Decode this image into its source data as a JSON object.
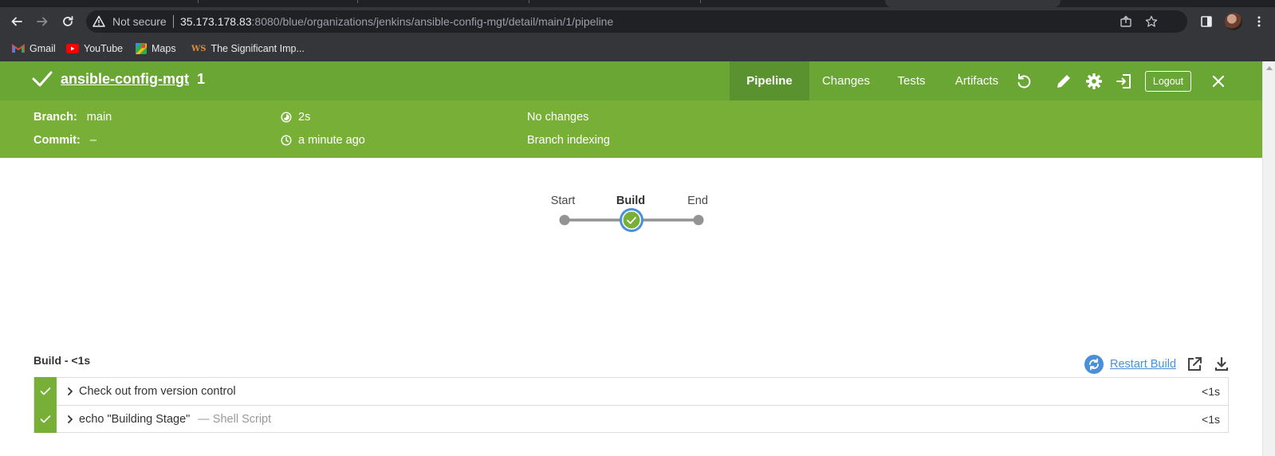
{
  "browser": {
    "security_label": "Not secure",
    "url_host": "35.173.178.83",
    "url_rest": ":8080/blue/organizations/jenkins/ansible-config-mgt/detail/main/1/pipeline",
    "bookmarks": [
      {
        "label": "Gmail",
        "icon": "gmail-icon"
      },
      {
        "label": "YouTube",
        "icon": "youtube-icon"
      },
      {
        "label": "Maps",
        "icon": "maps-icon"
      },
      {
        "label": "The Significant Imp...",
        "icon": "ws-icon"
      }
    ]
  },
  "run": {
    "status": "success",
    "pipeline_name": "ansible-config-mgt",
    "run_number": "1"
  },
  "tabs": [
    {
      "label": "Pipeline",
      "active": true
    },
    {
      "label": "Changes",
      "active": false
    },
    {
      "label": "Tests",
      "active": false
    },
    {
      "label": "Artifacts",
      "active": false
    }
  ],
  "header_actions": {
    "logout_label": "Logout",
    "icons": [
      "replay-icon",
      "edit-icon",
      "settings-icon",
      "exit-icon",
      "close-icon"
    ]
  },
  "meta": {
    "branch_label": "Branch:",
    "branch_value": "main",
    "commit_label": "Commit:",
    "commit_value": "–",
    "duration": "2s",
    "started": "a minute ago",
    "changes": "No changes",
    "cause": "Branch indexing"
  },
  "graph": {
    "stages": [
      {
        "label": "Start",
        "kind": "start"
      },
      {
        "label": "Build",
        "kind": "stage",
        "status": "success",
        "selected": true
      },
      {
        "label": "End",
        "kind": "end"
      }
    ]
  },
  "steps_panel": {
    "title": "Build - <1s",
    "restart_label": "Restart Build",
    "steps": [
      {
        "label": "Check out from version control",
        "sub": "",
        "duration": "<1s",
        "status": "success"
      },
      {
        "label": "echo \"Building Stage\"",
        "sub": "— Shell Script",
        "duration": "<1s",
        "status": "success"
      }
    ]
  },
  "colors": {
    "header_green": "#6aa634",
    "subheader_green": "#78b037",
    "active_tab": "#5b9230",
    "selected_ring": "#4a90d9",
    "link_blue": "#4a90d9"
  }
}
